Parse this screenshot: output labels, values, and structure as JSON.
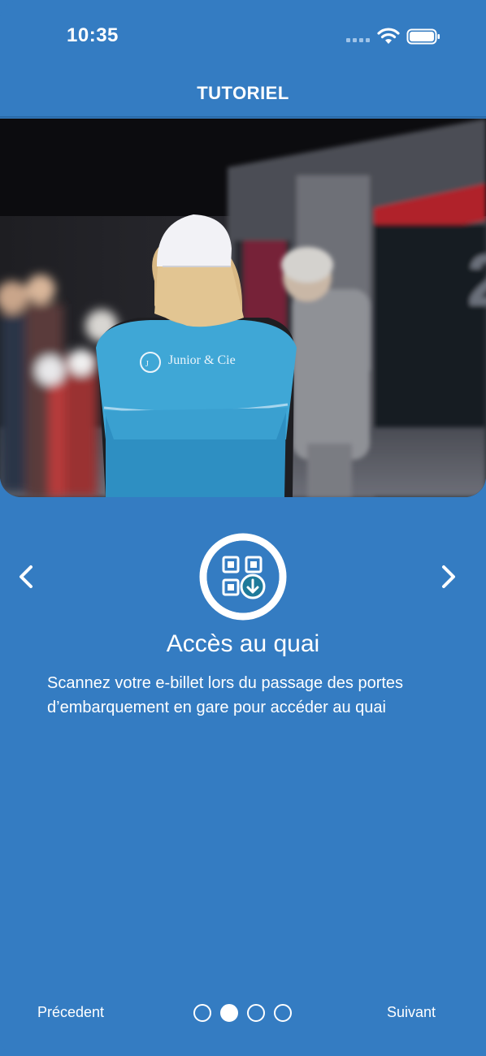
{
  "status_bar": {
    "time": "10:35"
  },
  "header": {
    "title": "TUTORIEL"
  },
  "hero": {
    "vest_text": "Junior & Cie"
  },
  "slide": {
    "title": "Accès au quai",
    "description": "Scannez votre e-billet lors du passage des portes d’embarquement en gare  pour accéder au quai",
    "icon": "qr-code-download-icon"
  },
  "footer": {
    "prev_label": "Précedent",
    "next_label": "Suivant",
    "page_count": 4,
    "active_page": 2
  },
  "colors": {
    "background": "#347cc2",
    "accent": "#1f7a9a",
    "text": "#ffffff"
  }
}
